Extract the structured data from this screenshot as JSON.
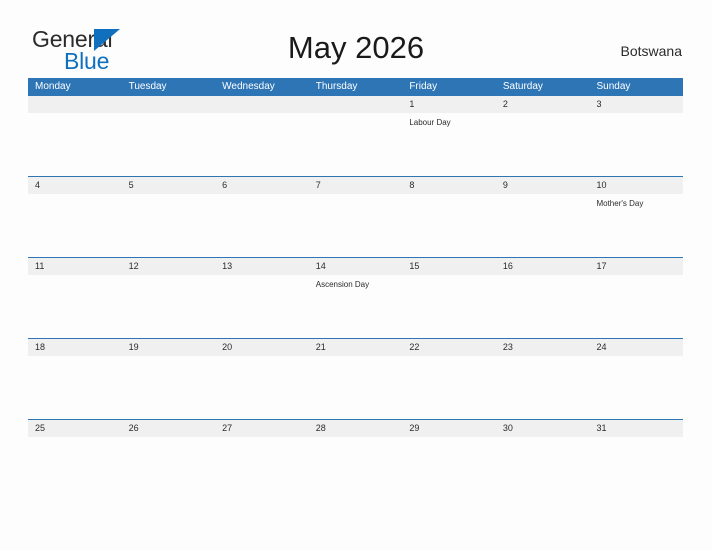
{
  "brand": {
    "name_part1": "General",
    "name_part2": "Blue",
    "flag_icon": "triangle-flag-icon",
    "logo_blue": "#1070be",
    "text_dark": "#2b2b2b"
  },
  "header": {
    "title": "May 2026",
    "country": "Botswana",
    "header_blue": "#2e75b6"
  },
  "calendar": {
    "weekdays": [
      "Monday",
      "Tuesday",
      "Wednesday",
      "Thursday",
      "Friday",
      "Saturday",
      "Sunday"
    ],
    "weeks": [
      {
        "dates": [
          "",
          "",
          "",
          "",
          "1",
          "2",
          "3"
        ],
        "events": [
          "",
          "",
          "",
          "",
          "Labour Day",
          "",
          ""
        ]
      },
      {
        "dates": [
          "4",
          "5",
          "6",
          "7",
          "8",
          "9",
          "10"
        ],
        "events": [
          "",
          "",
          "",
          "",
          "",
          "",
          "Mother's Day"
        ]
      },
      {
        "dates": [
          "11",
          "12",
          "13",
          "14",
          "15",
          "16",
          "17"
        ],
        "events": [
          "",
          "",
          "",
          "Ascension Day",
          "",
          "",
          ""
        ]
      },
      {
        "dates": [
          "18",
          "19",
          "20",
          "21",
          "22",
          "23",
          "24"
        ],
        "events": [
          "",
          "",
          "",
          "",
          "",
          "",
          ""
        ]
      },
      {
        "dates": [
          "25",
          "26",
          "27",
          "28",
          "29",
          "30",
          "31"
        ],
        "events": [
          "",
          "",
          "",
          "",
          "",
          "",
          ""
        ]
      }
    ]
  }
}
